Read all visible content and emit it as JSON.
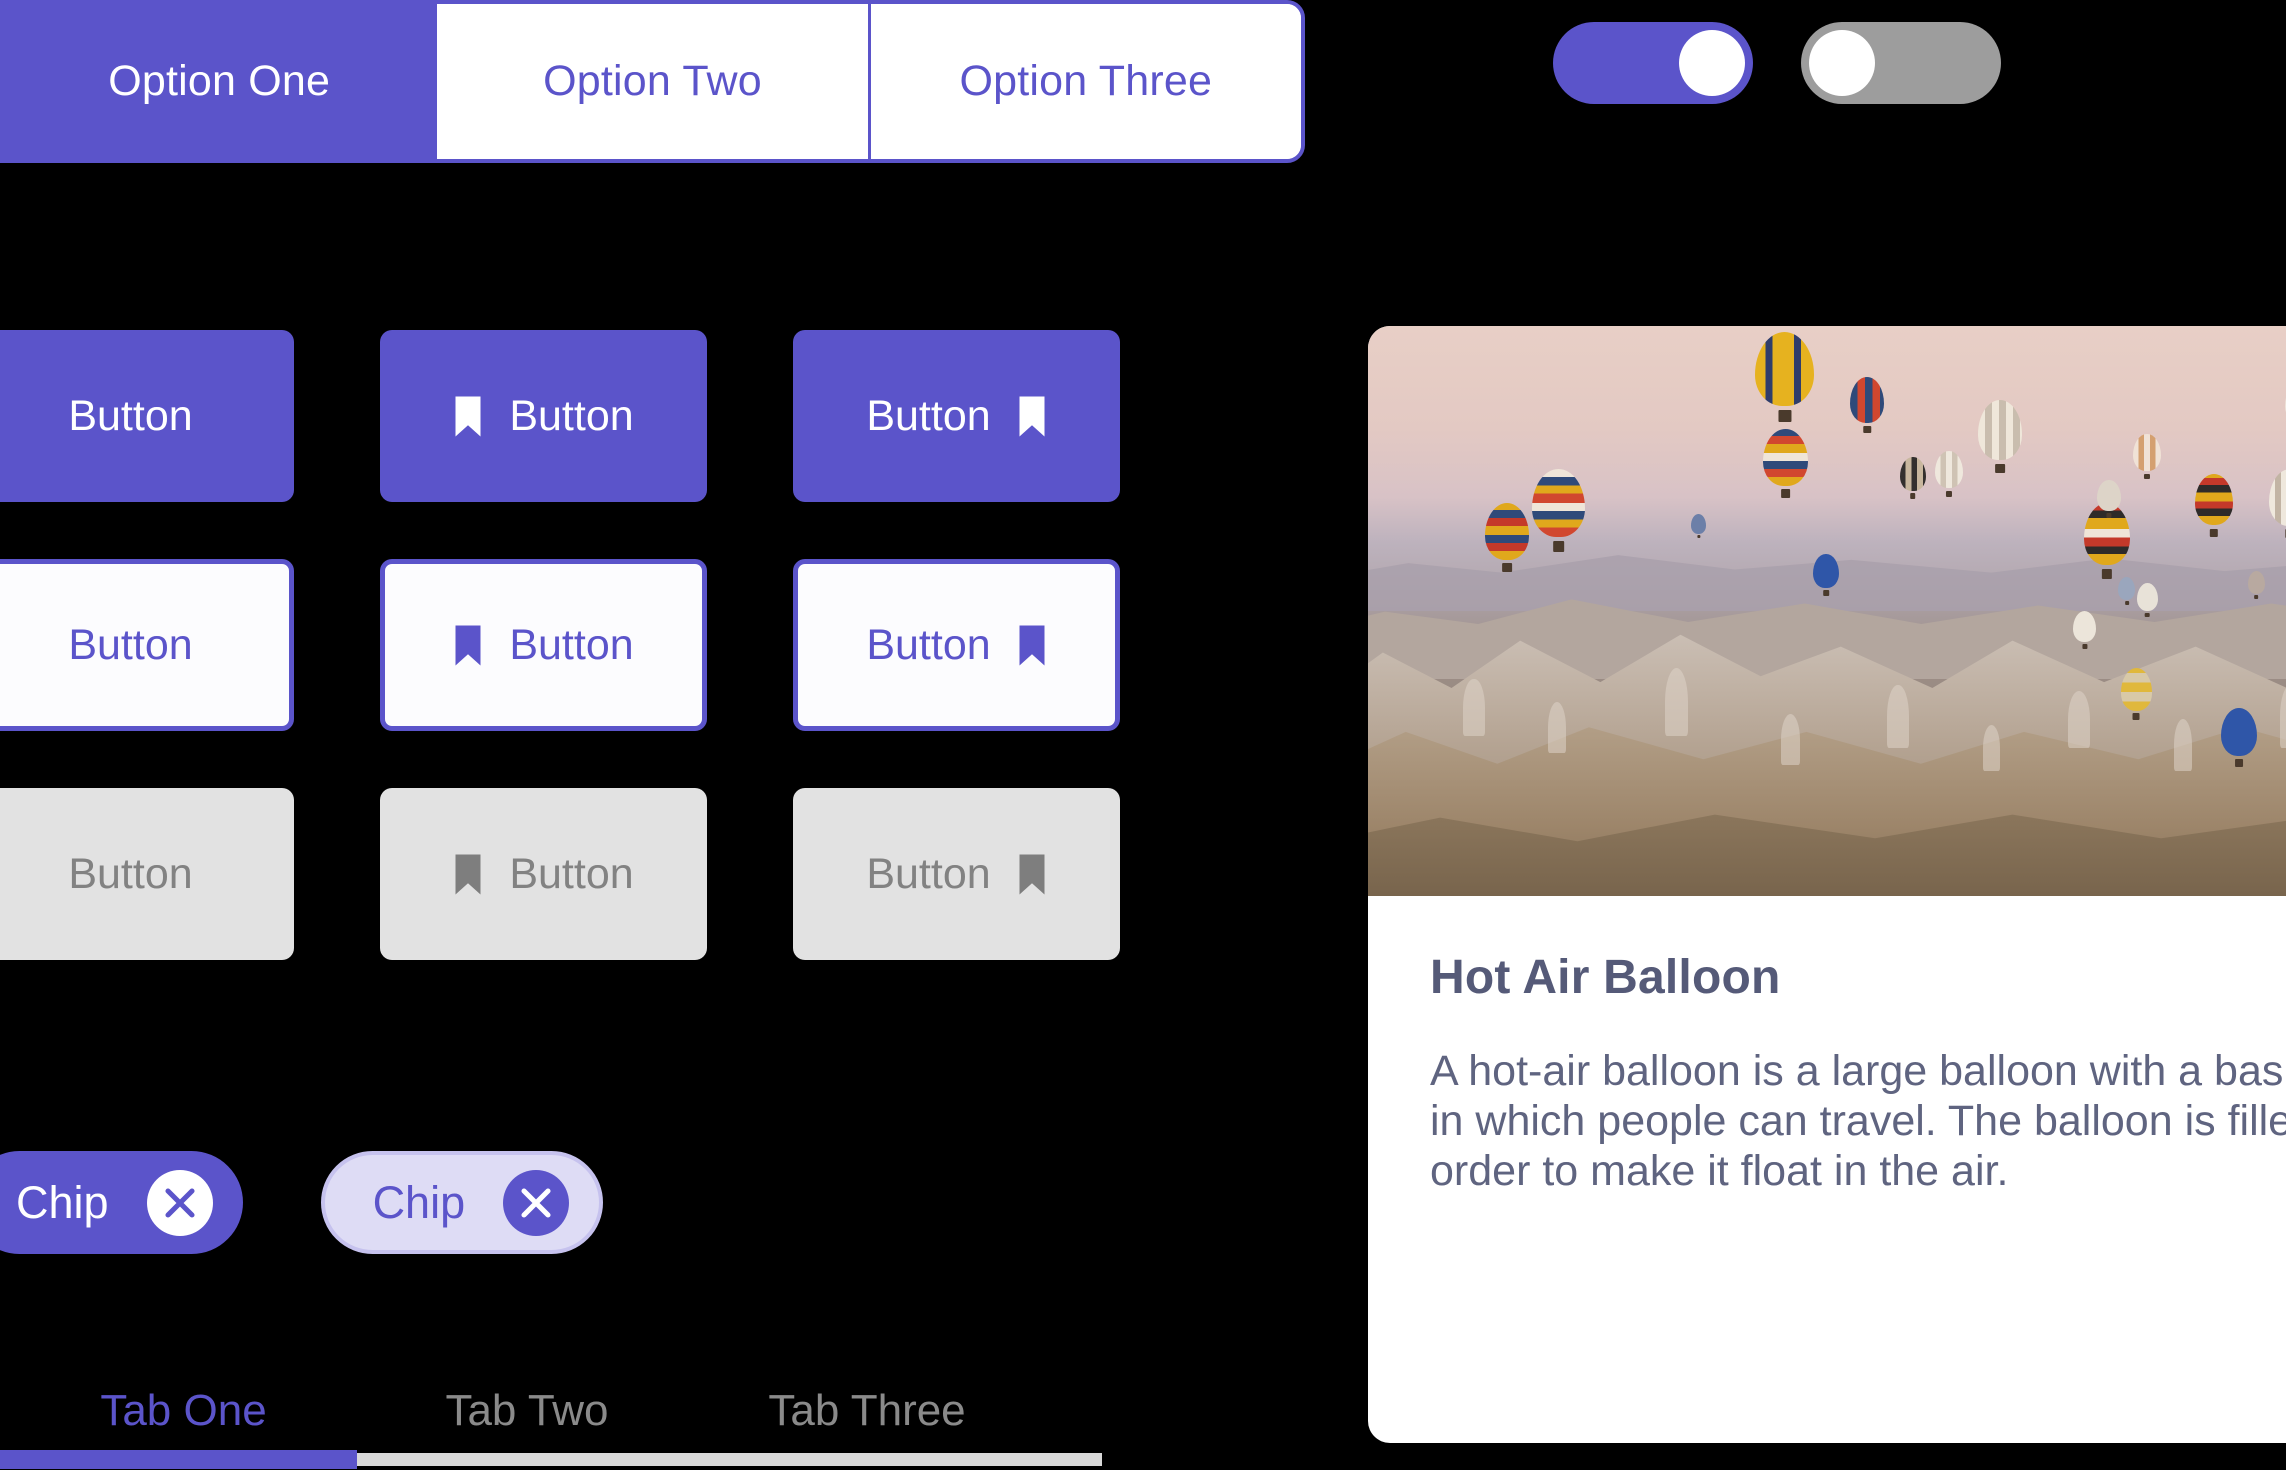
{
  "theme": {
    "background": "#000000",
    "accent": "#5B54CA",
    "accent_soft": "#DEDCF5",
    "disabled_bg": "#E2E2E2",
    "disabled_fg": "#828282",
    "card_bg": "#FFFFFF",
    "card_title_color": "#555A78",
    "card_text_color": "#5F6480",
    "toggle_off": "#9D9D9D",
    "tab_inactive": "#8A8A8A",
    "tab_track": "#D9D9D9"
  },
  "segmented_control": {
    "options": [
      {
        "label": "Option One",
        "selected": true
      },
      {
        "label": "Option Two",
        "selected": false
      },
      {
        "label": "Option Three",
        "selected": false
      }
    ]
  },
  "toggles": [
    {
      "name": "toggle-on",
      "state": "on"
    },
    {
      "name": "toggle-off",
      "state": "off"
    }
  ],
  "buttons": {
    "label": "Button",
    "icon": "bookmark-icon",
    "rows": [
      {
        "variant": "filled",
        "items": [
          {
            "label": "Button",
            "icon": "none"
          },
          {
            "label": "Button",
            "icon": "leading"
          },
          {
            "label": "Button",
            "icon": "trailing"
          }
        ]
      },
      {
        "variant": "outlined",
        "items": [
          {
            "label": "Button",
            "icon": "none"
          },
          {
            "label": "Button",
            "icon": "leading"
          },
          {
            "label": "Button",
            "icon": "trailing"
          }
        ]
      },
      {
        "variant": "disabled",
        "items": [
          {
            "label": "Button",
            "icon": "none"
          },
          {
            "label": "Button",
            "icon": "leading"
          },
          {
            "label": "Button",
            "icon": "trailing"
          }
        ]
      }
    ]
  },
  "chips": [
    {
      "label": "Chip",
      "variant": "solid",
      "remove_icon": "close-icon"
    },
    {
      "label": "Chip",
      "variant": "soft",
      "remove_icon": "close-icon"
    }
  ],
  "tabs": {
    "items": [
      {
        "label": "Tab One",
        "active": true
      },
      {
        "label": "Tab Two",
        "active": false
      },
      {
        "label": "Tab Three",
        "active": false
      }
    ]
  },
  "card": {
    "image_alt": "hot-air-balloons-over-cappadocia",
    "title": "Hot Air Balloon",
    "body": "A hot-air balloon is a large balloon with a basket underneath in which people can travel. The balloon is filled with hot air in order to make it float in the air."
  }
}
